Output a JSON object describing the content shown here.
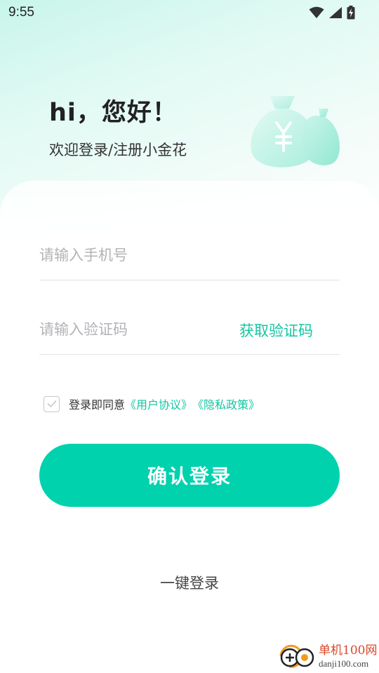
{
  "status_bar": {
    "time": "9:55",
    "icons": [
      "wifi-icon",
      "cellular-signal-icon",
      "battery-charging-icon"
    ]
  },
  "header": {
    "greeting": "hi，您好！",
    "welcome": "欢迎登录/注册小金花",
    "illustration": "money-bag-icon"
  },
  "form": {
    "phone_placeholder": "请输入手机号",
    "code_placeholder": "请输入验证码",
    "get_code_label": "获取验证码"
  },
  "agreement": {
    "checked": false,
    "prefix": "登录即同意",
    "user_agreement": "《用户协议》",
    "privacy_policy": "《隐私政策》"
  },
  "actions": {
    "confirm_label": "确认登录",
    "one_click_label": "一键登录"
  },
  "watermark": {
    "name": "单机100网",
    "domain": "danji100.com"
  },
  "colors": {
    "accent": "#00d2ae",
    "link": "#13c6a1",
    "header_bg": "#c8f5ea"
  }
}
